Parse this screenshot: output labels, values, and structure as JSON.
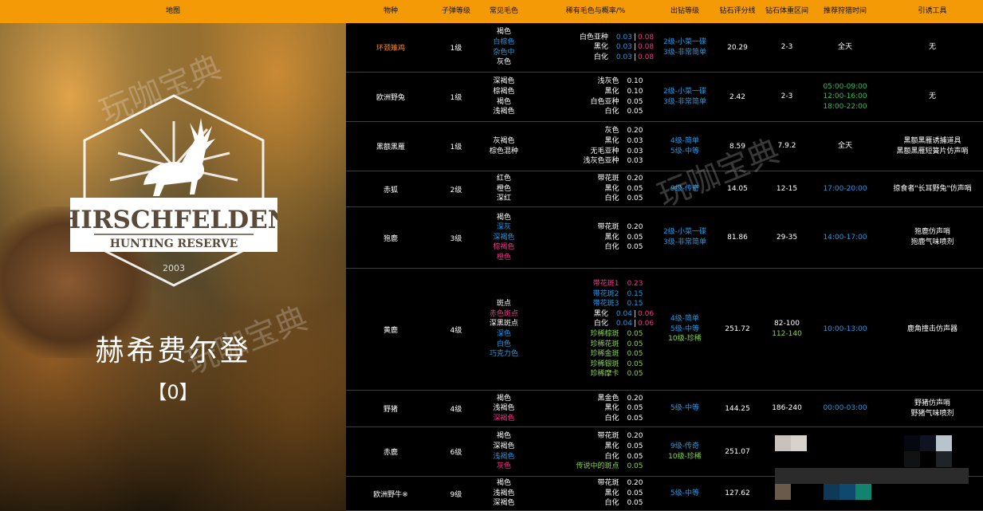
{
  "header": {
    "map": "地图",
    "species": "物种",
    "bullet": "子弹等级",
    "common_fur": "常见毛色",
    "rare_fur": "稀有毛色与概率/%",
    "diamond_level": "出钻等级",
    "diamond_score": "钻石评分线",
    "diamond_weight": "钻石体重区间",
    "best_time": "推荐狩猎时间",
    "lure": "引诱工具"
  },
  "map": {
    "logo_name": "HIRSCHFELDEN",
    "logo_sub": "HUNTING RESERVE",
    "logo_year": "2003",
    "title": "赫希费尔登",
    "count": "【0】"
  },
  "watermark": "玩咖宝典",
  "colors": {
    "header_bg": "#f39a06",
    "blue": "#1e9be8",
    "pink": "#ff2e8c",
    "green": "#8bd34a",
    "orange": "#ff8c1a",
    "emerald": "#21c25e"
  },
  "rows": [
    {
      "species": "环颈雉鸡",
      "species_color": "orange",
      "bullet": "1级",
      "common": [
        {
          "t": "褐色",
          "c": "white"
        },
        {
          "t": "白棕色",
          "c": "blue"
        },
        {
          "t": "杂色中",
          "c": "blue"
        },
        {
          "t": "灰色",
          "c": "white"
        }
      ],
      "rare": [
        {
          "n": "白色亚种",
          "nc": "white",
          "v": "0.03",
          "vc": "blue",
          "v2": "0.08",
          "v2c": "pink"
        },
        {
          "n": "黑化",
          "nc": "white",
          "v": "0.03",
          "vc": "blue",
          "v2": "0.08",
          "v2c": "pink"
        },
        {
          "n": "白化",
          "nc": "white",
          "v": "0.03",
          "vc": "blue",
          "v2": "0.08",
          "v2c": "pink"
        }
      ],
      "level": [
        {
          "t": "2级-小菜一碟",
          "c": "blue"
        },
        {
          "t": "3级-非常简单",
          "c": "blue"
        }
      ],
      "score": "20.29",
      "weight": [
        {
          "t": "2-3",
          "c": "white"
        }
      ],
      "time": [
        {
          "t": "全天",
          "c": "white"
        }
      ],
      "lure": [
        "无"
      ]
    },
    {
      "species": "欧洲野兔",
      "species_color": "white",
      "bullet": "1级",
      "common": [
        {
          "t": "深褐色",
          "c": "white"
        },
        {
          "t": "棕褐色",
          "c": "white"
        },
        {
          "t": "褐色",
          "c": "white"
        },
        {
          "t": "浅褐色",
          "c": "white"
        }
      ],
      "rare": [
        {
          "n": "浅灰色",
          "nc": "white",
          "v": "0.10",
          "vc": "white"
        },
        {
          "n": "黑化",
          "nc": "white",
          "v": "0.10",
          "vc": "white"
        },
        {
          "n": "白色亚种",
          "nc": "white",
          "v": "0.05",
          "vc": "white"
        },
        {
          "n": "白化",
          "nc": "white",
          "v": "0.05",
          "vc": "white"
        }
      ],
      "level": [
        {
          "t": "2级-小菜一碟",
          "c": "blue"
        },
        {
          "t": "3级-非常简单",
          "c": "blue"
        }
      ],
      "score": "2.42",
      "weight": [
        {
          "t": "2-3",
          "c": "white"
        }
      ],
      "time": [
        {
          "t": "05:00-09:00",
          "c": "emerald"
        },
        {
          "t": "12:00-16:00",
          "c": "emerald"
        },
        {
          "t": "18:00-22:00",
          "c": "emerald"
        }
      ],
      "lure": [
        "无"
      ]
    },
    {
      "species": "黑额黑雁",
      "species_color": "white",
      "bullet": "1级",
      "common": [
        {
          "t": "灰褐色",
          "c": "white"
        },
        {
          "t": "棕色混种",
          "c": "white"
        }
      ],
      "rare": [
        {
          "n": "灰色",
          "nc": "white",
          "v": "0.20",
          "vc": "white"
        },
        {
          "n": "黑化",
          "nc": "white",
          "v": "0.03",
          "vc": "white"
        },
        {
          "n": "无毛亚种",
          "nc": "white",
          "v": "0.03",
          "vc": "white"
        },
        {
          "n": "浅灰色亚种",
          "nc": "white",
          "v": "0.03",
          "vc": "white"
        }
      ],
      "level": [
        {
          "t": "4级-简单",
          "c": "blue"
        },
        {
          "t": "5级-中等",
          "c": "blue"
        }
      ],
      "score": "8.59",
      "weight": [
        {
          "t": "7.9.2",
          "c": "white"
        }
      ],
      "time": [
        {
          "t": "全天",
          "c": "white"
        }
      ],
      "lure": [
        "黑额黑雁诱捕道具",
        "黑额黑雁短簧片仿声哨"
      ]
    },
    {
      "species": "赤狐",
      "species_color": "white",
      "bullet": "2级",
      "common": [
        {
          "t": "红色",
          "c": "white"
        },
        {
          "t": "橙色",
          "c": "white"
        },
        {
          "t": "深红",
          "c": "white"
        }
      ],
      "rare": [
        {
          "n": "带花斑",
          "nc": "white",
          "v": "0.20",
          "vc": "white"
        },
        {
          "n": "黑化",
          "nc": "white",
          "v": "0.05",
          "vc": "white"
        },
        {
          "n": "白化",
          "nc": "white",
          "v": "0.05",
          "vc": "white"
        }
      ],
      "level": [
        {
          "t": "9级-传奇",
          "c": "blue"
        }
      ],
      "score": "14.05",
      "weight": [
        {
          "t": "12-15",
          "c": "white"
        }
      ],
      "time": [
        {
          "t": "17:00-20:00",
          "c": "blue"
        }
      ],
      "lure": [
        "掠食者\"长耳野兔\"仿声哨"
      ]
    },
    {
      "species": "狍鹿",
      "species_color": "white",
      "bullet": "3级",
      "common": [
        {
          "t": "褐色",
          "c": "white"
        },
        {
          "t": "深灰",
          "c": "blue"
        },
        {
          "t": "深褐色",
          "c": "blue"
        },
        {
          "t": "棕褐色",
          "c": "pink"
        },
        {
          "t": "橙色",
          "c": "pink"
        }
      ],
      "rare": [
        {
          "n": "带花斑",
          "nc": "white",
          "v": "0.20",
          "vc": "white"
        },
        {
          "n": "黑化",
          "nc": "white",
          "v": "0.05",
          "vc": "white"
        },
        {
          "n": "白化",
          "nc": "white",
          "v": "0.05",
          "vc": "white"
        }
      ],
      "level": [
        {
          "t": "2级-小菜一碟",
          "c": "blue"
        },
        {
          "t": "3级-非常简单",
          "c": "blue"
        }
      ],
      "score": "81.86",
      "weight": [
        {
          "t": "29-35",
          "c": "white"
        }
      ],
      "time": [
        {
          "t": "14:00-17:00",
          "c": "blue"
        }
      ],
      "lure": [
        "狍鹿仿声哨",
        "狍鹿气味喷剂"
      ]
    },
    {
      "species": "黄鹿",
      "species_color": "white",
      "bullet": "4级",
      "common": [
        {
          "t": "斑点",
          "c": "white"
        },
        {
          "t": "赤色斑点",
          "c": "pink"
        },
        {
          "t": "深黑斑点",
          "c": "white"
        },
        {
          "t": "深色",
          "c": "blue"
        },
        {
          "t": "白色",
          "c": "blue"
        },
        {
          "t": "巧克力色",
          "c": "blue"
        }
      ],
      "rare": [
        {
          "n": "带花斑1",
          "nc": "pink",
          "v": "0.23",
          "vc": "pink"
        },
        {
          "n": "带花斑2",
          "nc": "blue",
          "v": "0.15",
          "vc": "blue"
        },
        {
          "n": "带花斑3",
          "nc": "blue",
          "v": "0.15",
          "vc": "blue"
        },
        {
          "n": "黑化",
          "nc": "white",
          "v": "0.04",
          "vc": "blue",
          "v2": "0.06",
          "v2c": "pink"
        },
        {
          "n": "白化",
          "nc": "white",
          "v": "0.04",
          "vc": "blue",
          "v2": "0.06",
          "v2c": "pink"
        },
        {
          "n": "珍稀棕斑",
          "nc": "green",
          "v": "0.05",
          "vc": "green"
        },
        {
          "n": "珍稀花斑",
          "nc": "green",
          "v": "0.05",
          "vc": "green"
        },
        {
          "n": "珍稀金斑",
          "nc": "green",
          "v": "0.05",
          "vc": "green"
        },
        {
          "n": "珍稀银斑",
          "nc": "green",
          "v": "0.05",
          "vc": "green"
        },
        {
          "n": "珍稀摩卡",
          "nc": "green",
          "v": "0.05",
          "vc": "green"
        }
      ],
      "level": [
        {
          "t": "4级-简单",
          "c": "blue"
        },
        {
          "t": "5级-中等",
          "c": "blue"
        },
        {
          "t": "10级-珍稀",
          "c": "green"
        }
      ],
      "score": "251.72",
      "weight": [
        {
          "t": "82-100",
          "c": "white"
        },
        {
          "t": "112-140",
          "c": "green"
        }
      ],
      "time": [
        {
          "t": "10:00-13:00",
          "c": "blue"
        }
      ],
      "lure": [
        "鹿角撞击仿声器"
      ]
    },
    {
      "species": "野猪",
      "species_color": "white",
      "bullet": "4级",
      "common": [
        {
          "t": "褐色",
          "c": "white"
        },
        {
          "t": "浅褐色",
          "c": "white"
        },
        {
          "t": "深褐色",
          "c": "pink"
        }
      ],
      "rare": [
        {
          "n": "黑金色",
          "nc": "white",
          "v": "0.20",
          "vc": "white"
        },
        {
          "n": "黑化",
          "nc": "white",
          "v": "0.05",
          "vc": "white"
        },
        {
          "n": "白化",
          "nc": "white",
          "v": "0.05",
          "vc": "white"
        }
      ],
      "level": [
        {
          "t": "5级-中等",
          "c": "blue"
        }
      ],
      "score": "144.25",
      "weight": [
        {
          "t": "186-240",
          "c": "white"
        }
      ],
      "time": [
        {
          "t": "00:00-03:00",
          "c": "blue"
        }
      ],
      "lure": [
        "野猪仿声哨",
        "野猪气味喷剂"
      ]
    },
    {
      "species": "赤鹿",
      "species_color": "white",
      "bullet": "6级",
      "common": [
        {
          "t": "褐色",
          "c": "white"
        },
        {
          "t": "深褐色",
          "c": "white"
        },
        {
          "t": "浅褐色",
          "c": "blue"
        },
        {
          "t": "灰色",
          "c": "pink"
        }
      ],
      "rare": [
        {
          "n": "带花斑",
          "nc": "white",
          "v": "0.20",
          "vc": "white"
        },
        {
          "n": "黑化",
          "nc": "white",
          "v": "0.05",
          "vc": "white"
        },
        {
          "n": "白化",
          "nc": "white",
          "v": "0.05",
          "vc": "white"
        },
        {
          "n": "传说中的斑点",
          "nc": "green",
          "v": "0.05",
          "vc": "green"
        }
      ],
      "level": [
        {
          "t": "9级-传奇",
          "c": "blue"
        },
        {
          "t": "10级-珍稀",
          "c": "green"
        }
      ],
      "score": "251.07",
      "weight": [],
      "time": [],
      "lure": []
    },
    {
      "species": "欧洲野牛※",
      "species_color": "white",
      "bullet": "9级",
      "common": [
        {
          "t": "褐色",
          "c": "white"
        },
        {
          "t": "浅褐色",
          "c": "white"
        },
        {
          "t": "深褐色",
          "c": "white"
        }
      ],
      "rare": [
        {
          "n": "带花斑",
          "nc": "white",
          "v": "0.20",
          "vc": "white"
        },
        {
          "n": "黑化",
          "nc": "white",
          "v": "0.05",
          "vc": "white"
        },
        {
          "n": "白化",
          "nc": "white",
          "v": "0.05",
          "vc": "white"
        }
      ],
      "level": [
        {
          "t": "5级-中等",
          "c": "blue"
        }
      ],
      "score": "127.62",
      "weight": [],
      "time": [],
      "lure": []
    }
  ]
}
